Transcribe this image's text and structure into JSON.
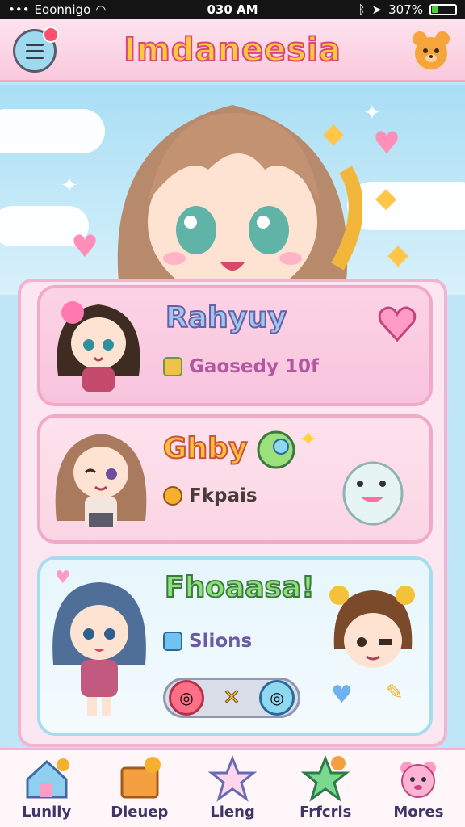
{
  "status_bar": {
    "carrier": "Eoonnigo",
    "time": "030 AM",
    "battery": "307%",
    "battery_level": 0.3
  },
  "header": {
    "title": "Imdaneesia",
    "menu_icon": "menu-icon",
    "profile_icon": "bear-icon"
  },
  "cards": [
    {
      "name": "Rahyuy",
      "subtitle": "Gaosedy 10f",
      "subtitle_icon": "pencil-square-icon",
      "action_icon": "heart-icon"
    },
    {
      "name": "Ghby",
      "subtitle": "Fkpais",
      "subtitle_icon": "coin-icon",
      "action_icon": "bubble-icon"
    },
    {
      "name": "Fhoaasa!",
      "subtitle": "Slions",
      "subtitle_icon": "blue-square-icon"
    }
  ],
  "toggle": {
    "mid_symbol": "✕"
  },
  "colors": {
    "brand_pink": "#f9c9dc",
    "title_yellow": "#ffc93a",
    "title_outline": "#d9477f",
    "sky": "#bfe6f7"
  },
  "nav": [
    {
      "label": "Lunily",
      "icon": "house-icon"
    },
    {
      "label": "Dleuep",
      "icon": "box-icon"
    },
    {
      "label": "Lleng",
      "icon": "star-icon"
    },
    {
      "label": "Frfcris",
      "icon": "green-star-icon"
    },
    {
      "label": "Mores",
      "icon": "bear-icon"
    }
  ]
}
